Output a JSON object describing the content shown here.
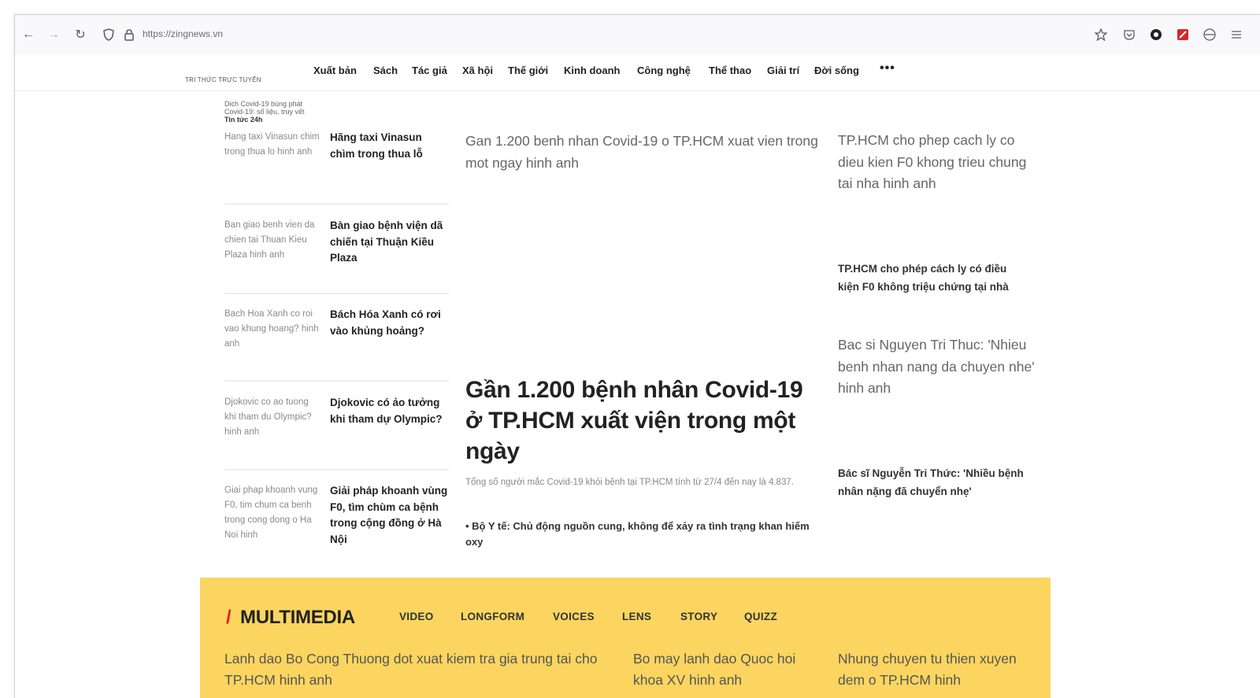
{
  "browser": {
    "url": "https://zingnews.vn",
    "back_icon": "←",
    "forward_icon": "→",
    "reload_icon": "↻"
  },
  "site": {
    "logo_text": "TRI THỨC TRỰC TUYẾN",
    "menu": [
      "Xuất bản",
      "Sách",
      "Tác giả",
      "Xã hội",
      "Thế giới",
      "Kinh doanh",
      "Công nghệ",
      "Thể thao",
      "Giải trí",
      "Đời sống"
    ],
    "more": "•••"
  },
  "trending": {
    "line1": "Dich Covid-19 bùng phát",
    "line2": "Covid-19: số liệu, truy vết",
    "tag": "Tin tức 24h"
  },
  "left_stories": [
    {
      "alt": "Hang taxi Vinasun chim trong thua lo hinh anh",
      "title": "Hãng taxi Vinasun chìm trong thua lỗ"
    },
    {
      "alt": "Ban giao benh vien da chien tai Thuan Kieu Plaza hinh anh",
      "title": "Bàn giao bệnh viện dã chiến tại Thuận Kiều Plaza"
    },
    {
      "alt": "Bach Hoa Xanh co roi vao khung hoang? hinh anh",
      "title": "Bách Hóa Xanh có rơi vào khủng hoảng?"
    },
    {
      "alt": "Djokovic co ao tuong khi tham du Olympic? hinh anh",
      "title": "Djokovic có ảo tưởng khi tham dự Olympic?"
    },
    {
      "alt": "Giai phap khoanh vung F0, tim chum ca benh trong cong dong o Ha Noi hinh",
      "title": "Giải pháp khoanh vùng F0, tìm chùm ca bệnh trong cộng đồng ở Hà Nội"
    }
  ],
  "center": {
    "image_alt": "Gan 1.200 benh nhan Covid-19 o TP.HCM xuat vien trong mot ngay hinh anh",
    "headline": "Gần 1.200 bệnh nhân Covid-19 ở TP.HCM xuất viện trong một ngày",
    "summary": "Tổng số người mắc Covid-19 khỏi bệnh tại TP.HCM tính từ 27/4 đến nay là 4.837.",
    "related": "• Bộ Y tế: Chủ động nguồn cung, không để xảy ra tình trạng khan hiếm oxy"
  },
  "right_stories": [
    {
      "alt": "TP.HCM cho phep cach ly co dieu kien F0 khong trieu chung tai nha hinh anh",
      "title": "TP.HCM cho phép cách ly có điều kiện F0 không triệu chứng tại nhà"
    },
    {
      "alt": "Bac si Nguyen Tri Thuc: 'Nhieu benh nhan nang da chuyen nhe' hinh anh",
      "title": "Bác sĩ Nguyễn Tri Thức: 'Nhiều bệnh nhân nặng đã chuyển nhẹ'"
    }
  ],
  "multimedia": {
    "slash": "/",
    "title": "MULTIMEDIA",
    "tabs": [
      "VIDEO",
      "LONGFORM",
      "VOICES",
      "LENS",
      "STORY",
      "QUIZZ"
    ],
    "items": [
      "Lanh dao Bo Cong Thuong dot xuat kiem tra gia trung tai cho TP.HCM hinh anh",
      "Bo may lanh dao Quoc hoi khoa XV hinh anh",
      "Nhung chuyen tu thien xuyen dem o TP.HCM hinh"
    ]
  },
  "colors": {
    "multimedia_bg": "#fbd560",
    "multimedia_slash": "#e2211c",
    "text_dark": "#222222",
    "text_alt": "#8a8a8a"
  }
}
